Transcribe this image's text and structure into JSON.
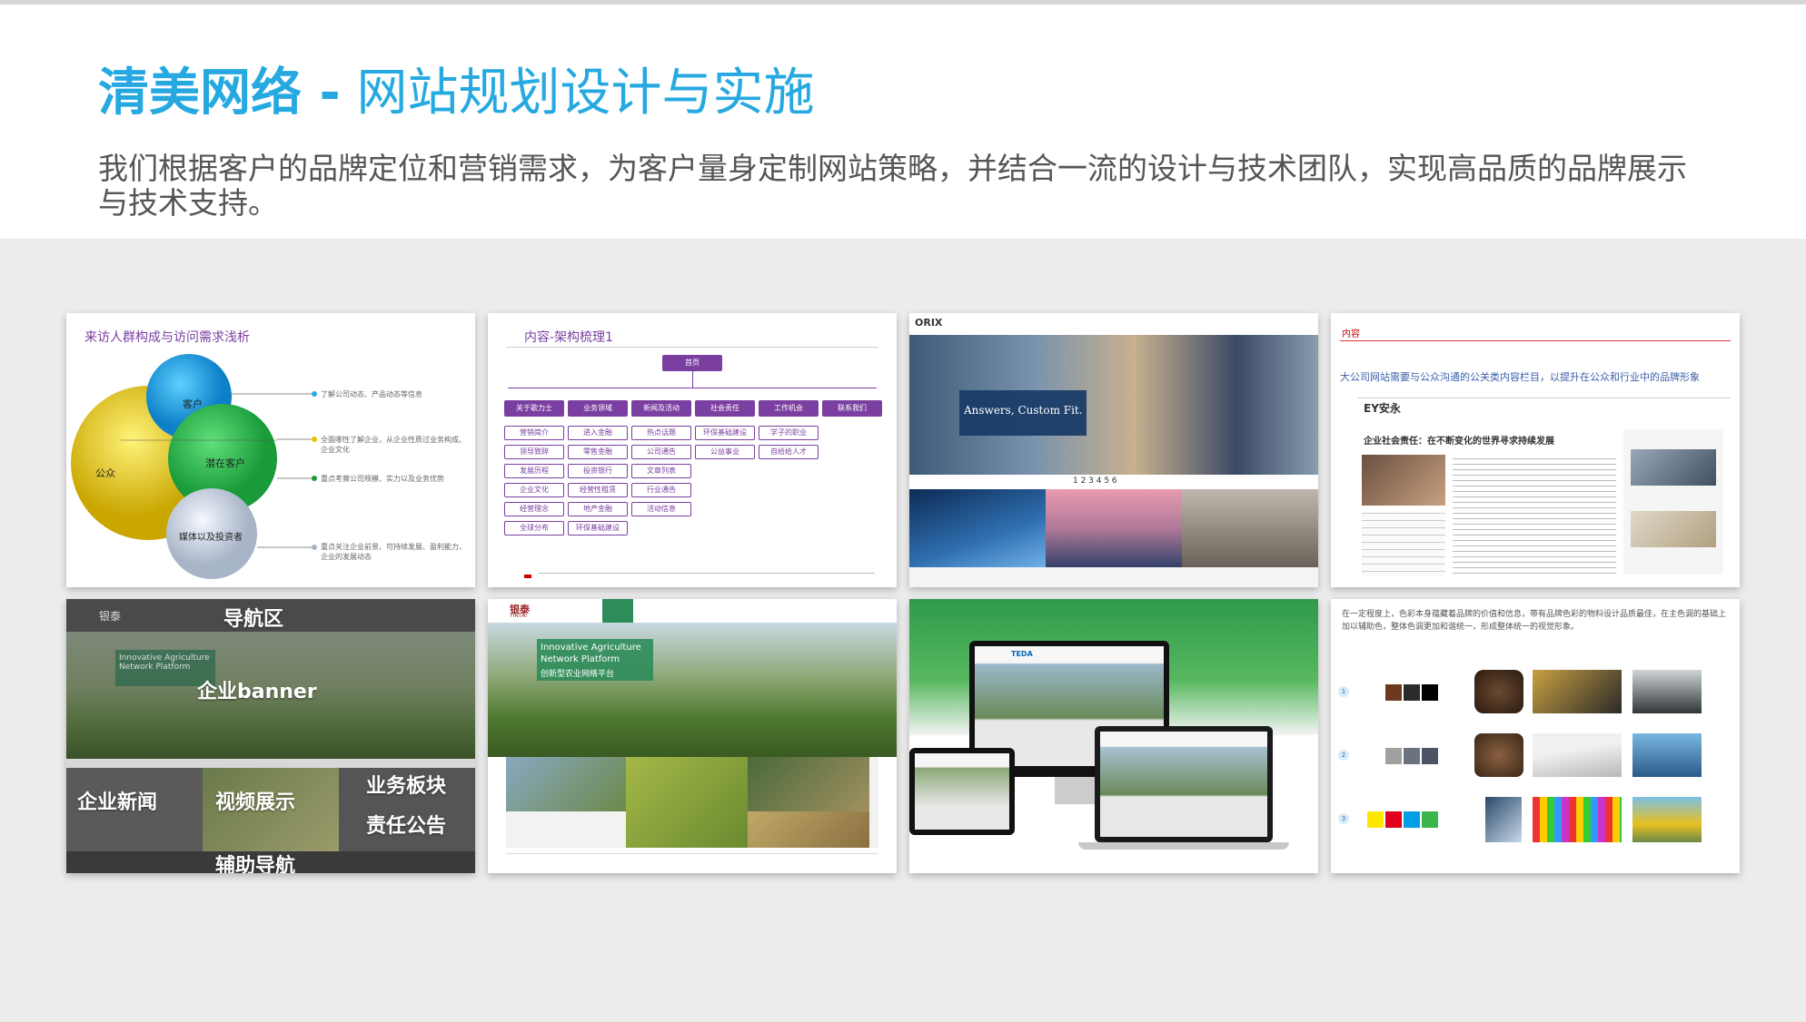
{
  "header": {
    "title_bold": "清美网络 -",
    "title_light": " 网站规划设计与实施",
    "subtitle": "我们根据客户的品牌定位和营销需求，为客户量身定制网站策略，并结合一流的设计与技术团队，实现高品质的品牌展示与技术支持。"
  },
  "thumb1": {
    "title": "来访人群构成与访问需求浅析",
    "circles": [
      "客户",
      "潜在客户",
      "公众",
      "媒体以及投资者"
    ],
    "notes": [
      "了解公司动态、产品动态等信息",
      "全面哪性了解企业，从企业性质过业务构成、企业文化",
      "重点考察公司规模、实力以及业务优势",
      "重点关注企业前景、可持续发展、盈利能力、企业的发展动态"
    ]
  },
  "thumb2": {
    "title": "内容-架构梳理1",
    "root": "首页",
    "top": [
      "关于歌力士",
      "业务领域",
      "新闻及活动",
      "社会责任",
      "工作机会",
      "联系我们"
    ],
    "sub": [
      [
        "营销简介",
        "领导致辞",
        "发展历程",
        "企业文化",
        "经营理念",
        "全球分布"
      ],
      [
        "进入金融",
        "零售金融",
        "投资银行",
        "经营性租赁",
        "地产金融",
        "环保基础建设"
      ],
      [
        "热点话题",
        "公司通告",
        "文章列表",
        "行业通告",
        "活动信息"
      ],
      [
        "环保基础建设",
        "公益事业"
      ],
      [
        "学子的职业",
        "自给给人才"
      ]
    ]
  },
  "thumb3": {
    "logo": "ORIX",
    "slogan": "Answers, Custom Fit.",
    "pages": "1 2 3 4 5 6"
  },
  "thumb4": {
    "label": "内容",
    "headline": "大公司网站需要与公众沟通的公关类内容栏目，以提升在公众和行业中的品牌形象",
    "logo": "EY安永",
    "article_title": "企业社会责任：在不断变化的世界寻求持续发展"
  },
  "thumb5": {
    "logo": "银泰",
    "labels": [
      "导航区",
      "企业banner",
      "企业新闻",
      "视频展示",
      "业务板块",
      "责任公告",
      "辅助导航"
    ],
    "banner_en": "Innovative Agriculture Network Platform"
  },
  "thumb6": {
    "logo": "银泰",
    "logo_en": "YINTAI",
    "banner_en": "Innovative Agriculture Network Platform",
    "banner_cn": "创新型农业网络平台"
  },
  "thumb7": {
    "brand": "TEDA"
  },
  "thumb8": {
    "text": "在一定程度上，色彩本身蕴藏着品牌的价值和信息，带有品牌色彩的物料设计品质最佳，在主色调的基础上加以辅助色，整体色调更加和谐统一，形成整体统一的视觉形象。",
    "rows": [
      "1",
      "2",
      "3"
    ],
    "colors": [
      [
        "#6b3a1e",
        "#2b2b2b",
        "#000000"
      ],
      [
        "#a0a0a0",
        "#6b7280",
        "#4b5563"
      ],
      [
        "#ffe600",
        "#e0001b",
        "#009fe3",
        "#39b54a"
      ]
    ]
  }
}
